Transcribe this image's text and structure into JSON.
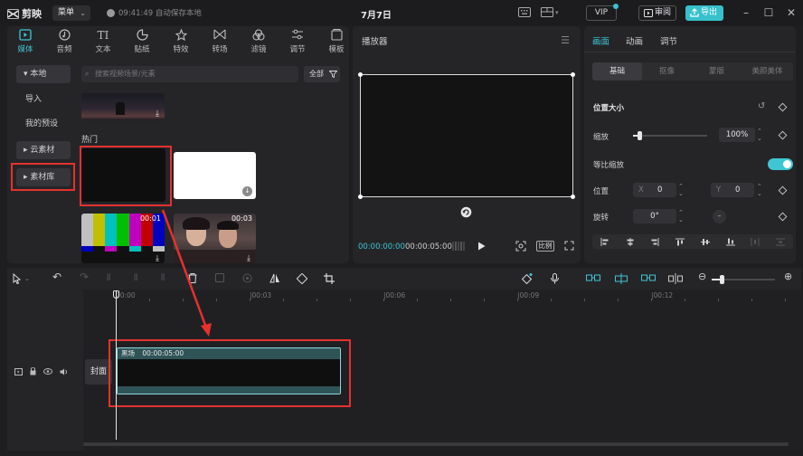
{
  "titlebar": {
    "app_name": "剪映",
    "menu_label": "菜单",
    "autosave_text": "09:41:49 自动保存本地",
    "project_title": "7月7日",
    "vip_label": "VIP",
    "review_label": "审阅",
    "export_label": "导出"
  },
  "media_toolbar": {
    "items": [
      {
        "label": "媒体"
      },
      {
        "label": "音频"
      },
      {
        "label": "文本"
      },
      {
        "label": "贴纸"
      },
      {
        "label": "特效"
      },
      {
        "label": "转场"
      },
      {
        "label": "滤镜"
      },
      {
        "label": "调节"
      },
      {
        "label": "模板"
      }
    ]
  },
  "media_sidebar": {
    "items": [
      {
        "label": "▾ 本地"
      },
      {
        "label": "导入"
      },
      {
        "label": "我的预设"
      },
      {
        "label": "▸ 云素材"
      },
      {
        "label": "▸ 素材库"
      }
    ]
  },
  "media_content": {
    "search_placeholder": "搜索视频场景/元素",
    "filter_label": "全部",
    "section_hot": "热门",
    "clips": [
      {
        "duration": "00:01"
      },
      {
        "duration": "00:03"
      }
    ]
  },
  "player": {
    "title": "播放器",
    "current_time": "00:00:00:00",
    "total_time": "00:00:05:00",
    "ratio_label": "比例"
  },
  "properties": {
    "tabs": [
      {
        "label": "画面"
      },
      {
        "label": "动画"
      },
      {
        "label": "调节"
      }
    ],
    "subtabs": [
      {
        "label": "基础"
      },
      {
        "label": "抠像"
      },
      {
        "label": "蒙版"
      },
      {
        "label": "美颜美体"
      }
    ],
    "position_size_label": "位置大小",
    "scale_label": "缩放",
    "scale_value": "100%",
    "scale_fraction": 0.09,
    "uniform_scale_label": "等比缩放",
    "uniform_scale_on": true,
    "position_label": "位置",
    "x_label": "X",
    "x_value": "0",
    "y_label": "Y",
    "y_value": "0",
    "rotate_label": "旋转",
    "rotate_value": "0°"
  },
  "timeline": {
    "ruler": [
      "00:00",
      "|00:03",
      "|00:06",
      "|00:09",
      "|00:12"
    ],
    "cover_label": "封面",
    "clip_label": "黑场",
    "clip_duration": "00:00:05:00"
  },
  "colors": {
    "accent": "#3fc6d3",
    "highlight_red": "#e5312f",
    "background": "#1e1e20",
    "panel": "#252528"
  }
}
